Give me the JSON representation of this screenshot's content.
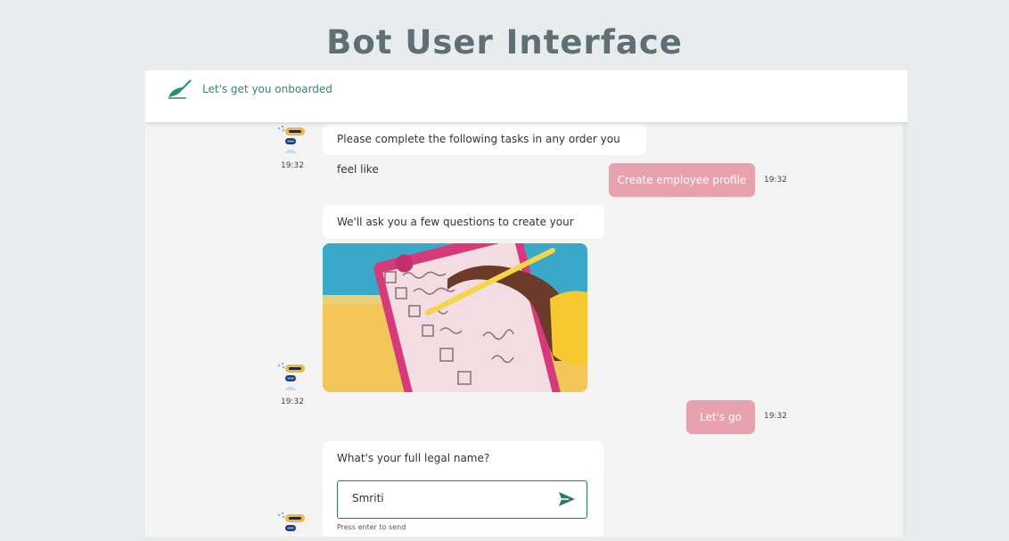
{
  "page": {
    "title": "Bot User Interface"
  },
  "header": {
    "text": "Let's get you onboarded"
  },
  "messages": {
    "m1": {
      "text": "Please complete the following tasks in any order you feel like",
      "time": "19:32"
    },
    "u1": {
      "text": "Create employee profile",
      "time": "19:32"
    },
    "m2": {
      "text": "We'll ask you a few questions to create your profile.",
      "time": "19:32"
    },
    "u2": {
      "text": "Let's go",
      "time": "19:32"
    },
    "m3": {
      "question": "What's your full legal name?",
      "input_value": "Smriti",
      "hint": "Press enter to send"
    }
  },
  "colors": {
    "accent": "#2d8a7a",
    "user_bubble": "#e8a2ad",
    "title": "#5e7075"
  },
  "icons": {
    "logo": "leaf-logo-icon",
    "avatar": "robot-avatar-icon",
    "send": "send-icon"
  }
}
